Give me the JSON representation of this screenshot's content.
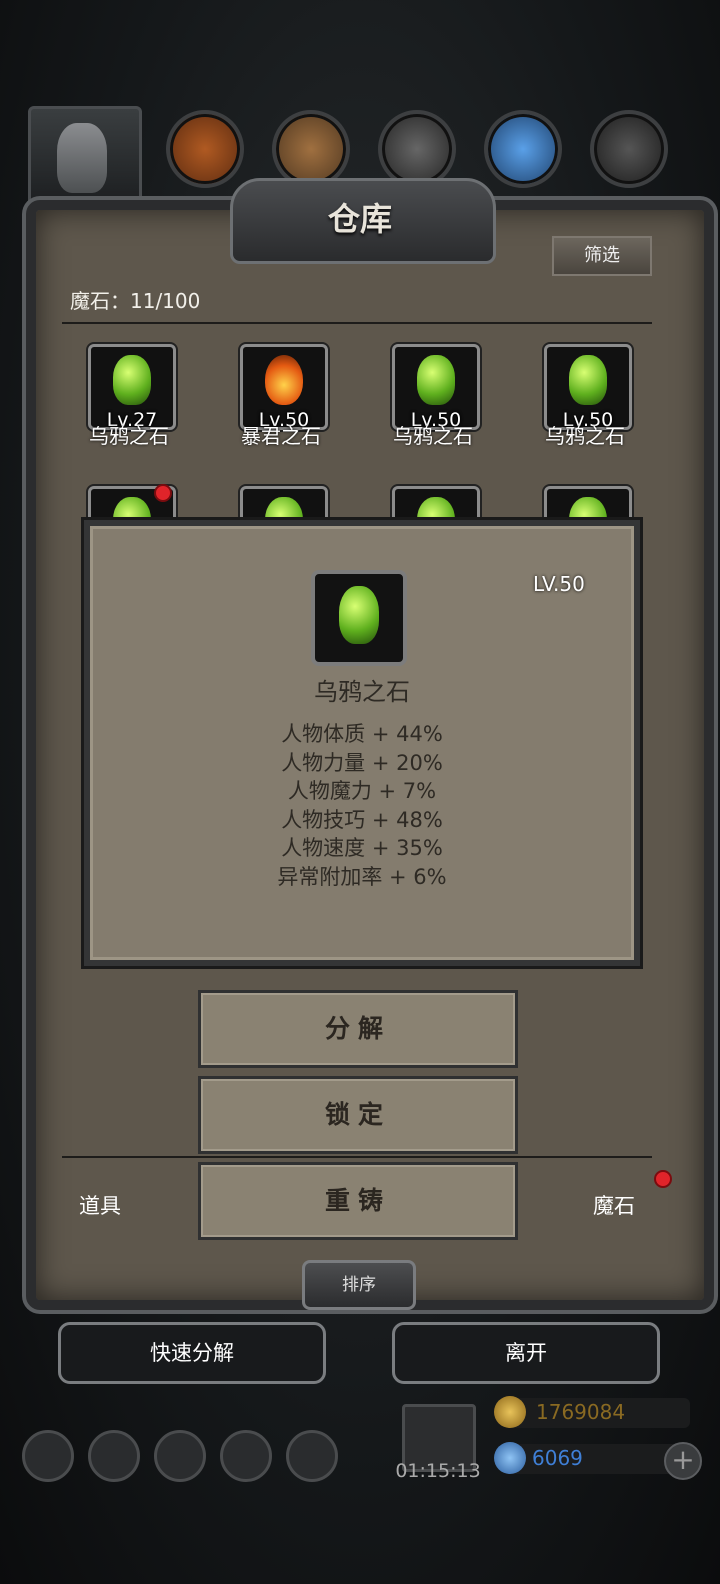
{
  "header": {
    "title": "仓库",
    "filter_label": "筛选"
  },
  "storage": {
    "count_text": "魔石：11/100"
  },
  "items": [
    {
      "level": "Lv.27",
      "name": "乌鸦之石",
      "type": "green"
    },
    {
      "level": "Lv.50",
      "name": "暴君之石",
      "type": "fire"
    },
    {
      "level": "Lv.50",
      "name": "乌鸦之石",
      "type": "green"
    },
    {
      "level": "Lv.50",
      "name": "乌鸦之石",
      "type": "green"
    }
  ],
  "popup": {
    "level": "LV.50",
    "name": "乌鸦之石",
    "stats": [
      "人物体质 + 44%",
      "人物力量 + 20%",
      "人物魔力 + 7%",
      "人物技巧 + 48%",
      "人物速度 + 35%",
      "异常附加率 + 6%"
    ]
  },
  "actions": {
    "decompose": "分解",
    "lock": "锁定",
    "reforge": "重铸"
  },
  "tabs": {
    "left": "道具",
    "right": "魔石"
  },
  "sort_label": "排序",
  "bottom": {
    "quick_decompose": "快速分解",
    "leave": "离开"
  },
  "footer": {
    "timer": "01:15:13",
    "gold": "1769084",
    "gems": "6069",
    "plus": "+"
  },
  "colors": {
    "panel": "#5e574c",
    "popup": "#847c6e",
    "gold_text": "#8a6a22",
    "gem_text": "#3f7fd6"
  }
}
